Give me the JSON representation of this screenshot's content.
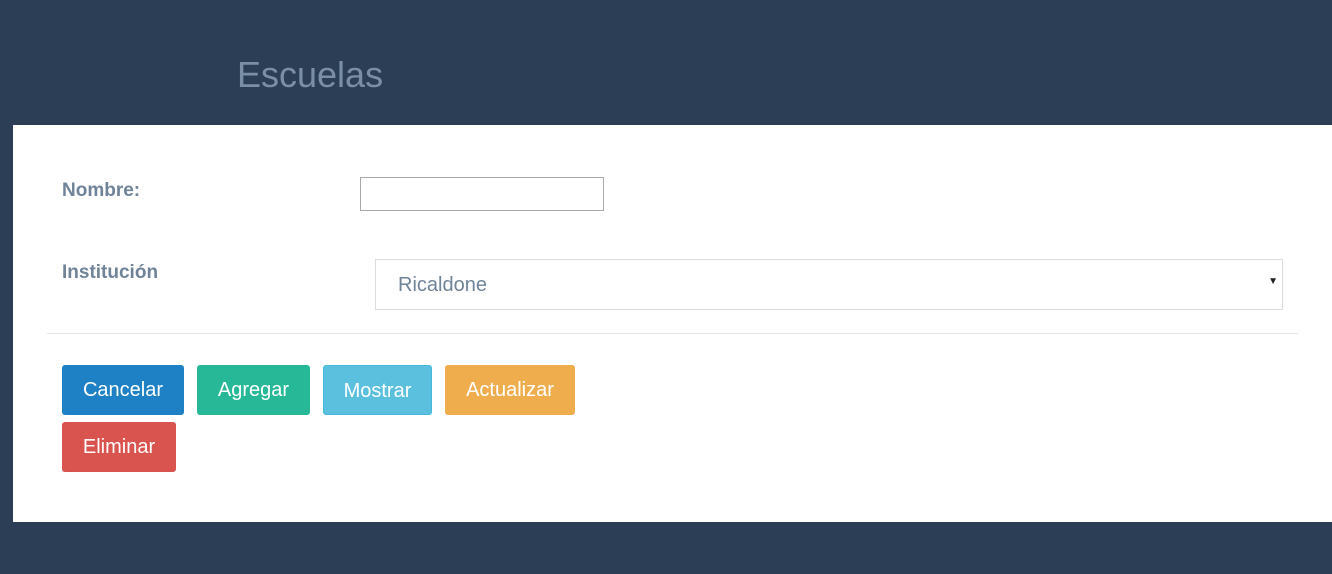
{
  "header": {
    "title": "Escuelas"
  },
  "form": {
    "nombre": {
      "label": "Nombre:",
      "value": "",
      "placeholder": ""
    },
    "institucion": {
      "label": "Institución",
      "selected": "Ricaldone"
    }
  },
  "buttons": {
    "cancelar": "Cancelar",
    "agregar": "Agregar",
    "mostrar": "Mostrar",
    "actualizar": "Actualizar",
    "eliminar": "Eliminar"
  },
  "colors": {
    "background": "#2c3e55",
    "cancelar": "#1e80c5",
    "agregar": "#27b898",
    "mostrar": "#5bc0de",
    "actualizar": "#f0ad4e",
    "eliminar": "#d9534f"
  },
  "icons": {
    "select_arrow": "caret-down-icon"
  }
}
